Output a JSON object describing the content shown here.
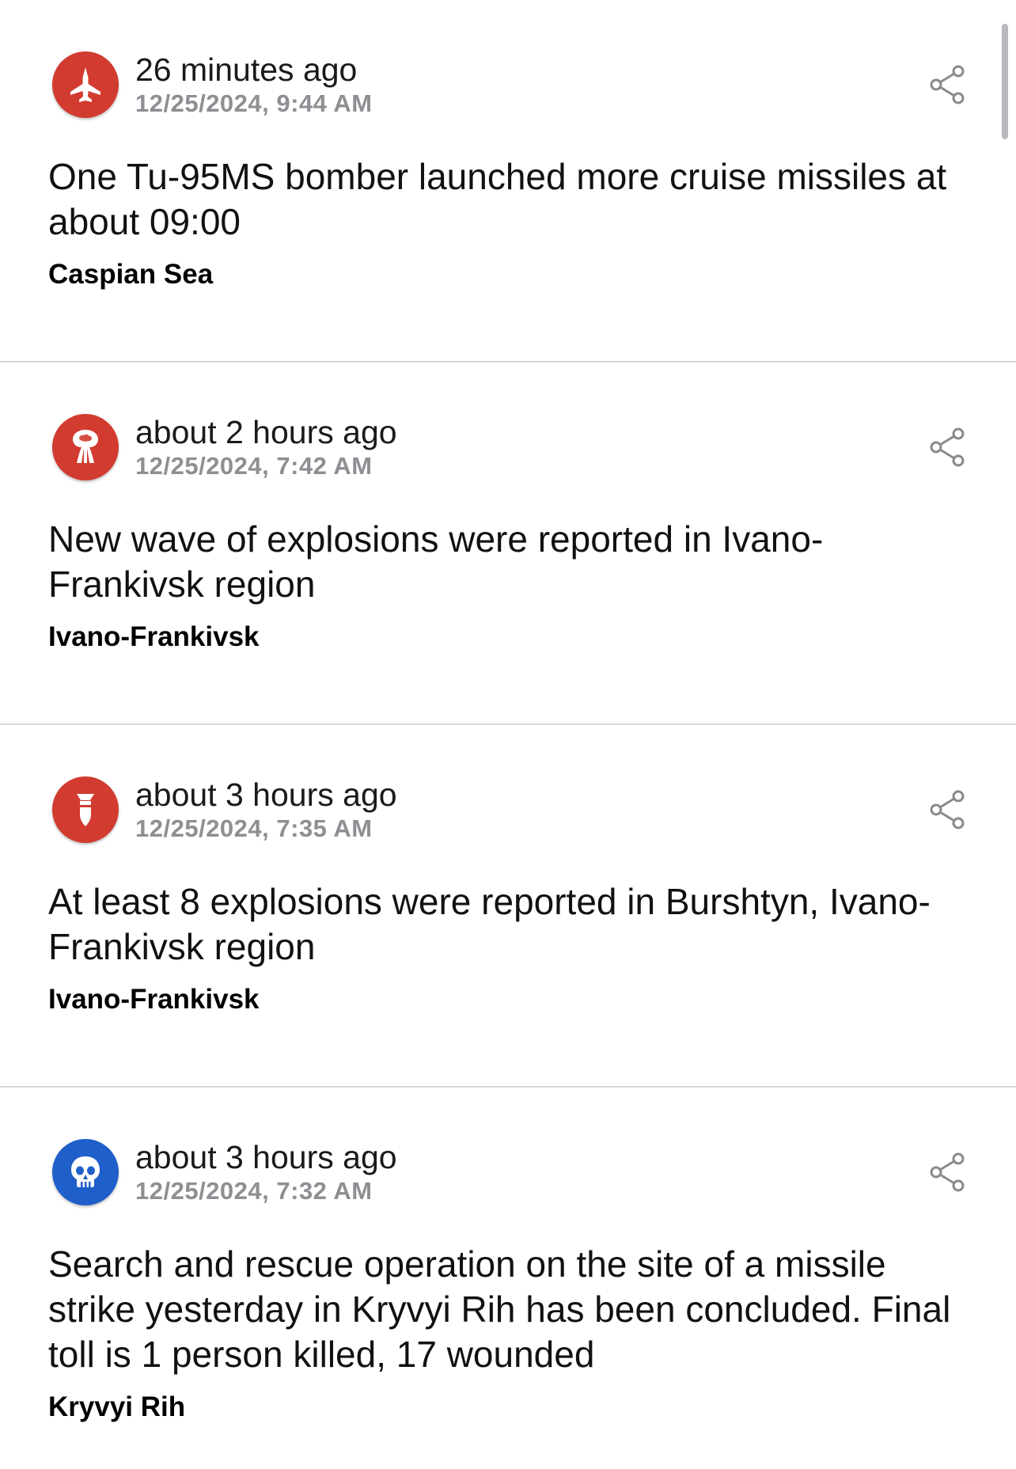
{
  "feed": {
    "items": [
      {
        "time_ago": "26 minutes ago",
        "timestamp": "12/25/2024, 9:44 AM",
        "message": "One Tu-95MS bomber launched more cruise missiles at about 09:00",
        "location": "Caspian Sea",
        "icon": "jet-icon",
        "icon_color": "#d23b2f"
      },
      {
        "time_ago": "about 2 hours ago",
        "timestamp": "12/25/2024, 7:42 AM",
        "message": "New wave of explosions were reported in Ivano-Frankivsk region",
        "location": "Ivano-Frankivsk",
        "icon": "explosion-icon",
        "icon_color": "#d23b2f"
      },
      {
        "time_ago": "about 3 hours ago",
        "timestamp": "12/25/2024, 7:35 AM",
        "message": "At least 8 explosions were reported in Burshtyn, Ivano-Frankivsk region",
        "location": "Ivano-Frankivsk",
        "icon": "bomb-icon",
        "icon_color": "#d23b2f"
      },
      {
        "time_ago": "about 3 hours ago",
        "timestamp": "12/25/2024, 7:32 AM",
        "message": "Search and rescue operation on the site of a missile strike yesterday in Kryvyi Rih has been concluded. Final toll is 1 person killed, 17 wounded",
        "location": "Kryvyi Rih",
        "icon": "skull-icon",
        "icon_color": "#1f5fc9"
      }
    ]
  }
}
